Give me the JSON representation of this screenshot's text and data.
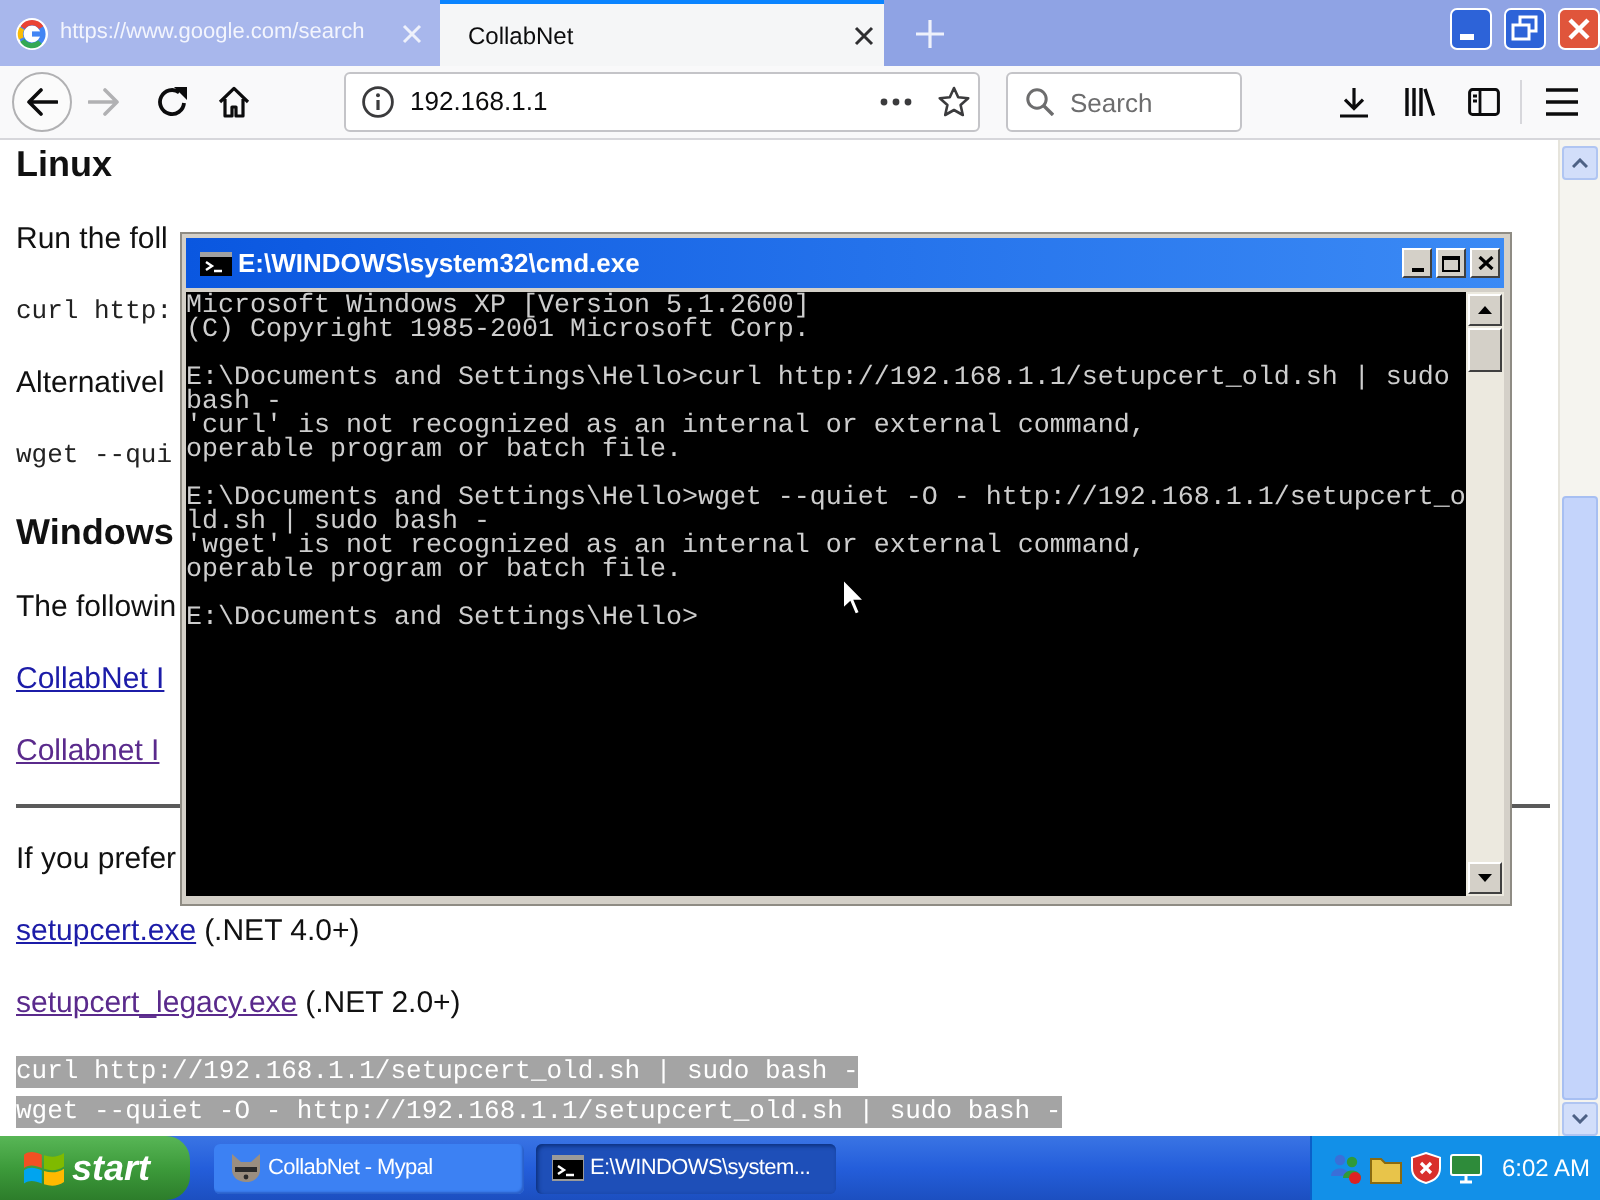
{
  "browser": {
    "tabs": [
      {
        "title": "https://www.google.com/search",
        "favicon": true,
        "selected": false
      },
      {
        "title": "CollabNet",
        "favicon": false,
        "selected": true
      }
    ],
    "nav_buttons": [
      {
        "kind": "back",
        "disabled": false
      },
      {
        "kind": "forward",
        "disabled": true
      },
      {
        "kind": "reload",
        "disabled": false
      },
      {
        "kind": "home",
        "disabled": false
      }
    ],
    "address": "192.168.1.1",
    "search": {
      "placeholder": "Search"
    }
  },
  "page": {
    "blocks": [
      {
        "kind": "heading",
        "text": "Linux"
      },
      {
        "kind": "paragraph",
        "text": "Run the foll"
      },
      {
        "kind": "code",
        "text": "curl http:",
        "selected": false
      },
      {
        "kind": "paragraph",
        "text": "Alternativel"
      },
      {
        "kind": "code",
        "text": "wget --qui",
        "selected": false
      },
      {
        "kind": "heading",
        "text": "Windows"
      },
      {
        "kind": "paragraph",
        "text": "The followin"
      },
      {
        "kind": "link",
        "text": "CollabNet I",
        "visited": false
      },
      {
        "kind": "link",
        "text": "Collabnet I",
        "visited": true
      },
      {
        "kind": "rule"
      },
      {
        "kind": "paragraph",
        "text": "If you prefer"
      },
      {
        "kind": "download",
        "link": "setupcert.exe",
        "visited": false,
        "note": "(.NET 4.0+)"
      },
      {
        "kind": "download",
        "link": "setupcert_legacy.exe",
        "visited": true,
        "note": "(.NET 2.0+)"
      },
      {
        "kind": "code",
        "text": "curl http://192.168.1.1/setupcert_old.sh | sudo bash -",
        "selected": true
      },
      {
        "kind": "code",
        "text": "wget --quiet -O - http://192.168.1.1/setupcert_old.sh | sudo bash -",
        "selected": true
      }
    ]
  },
  "console": {
    "title": "E:\\WINDOWS\\system32\\cmd.exe",
    "blocks": [
      [
        "Microsoft Windows XP [Version 5.1.2600]",
        "(C) Copyright 1985-2001 Microsoft Corp."
      ],
      [
        "E:\\Documents and Settings\\Hello>curl http://192.168.1.1/setupcert_old.sh | sudo",
        "bash -",
        "'curl' is not recognized as an internal or external command,",
        "operable program or batch file."
      ],
      [
        "E:\\Documents and Settings\\Hello>wget --quiet -O - http://192.168.1.1/setupcert_o",
        "ld.sh | sudo bash -",
        "'wget' is not recognized as an internal or external command,",
        "operable program or batch file."
      ],
      [
        "E:\\Documents and Settings\\Hello>"
      ]
    ]
  },
  "taskbar": {
    "start_label": "start",
    "tasks": [
      {
        "kind": "browser",
        "label": "CollabNet - Mypal",
        "selected": false
      },
      {
        "kind": "console",
        "label": "E:\\WINDOWS\\system...",
        "selected": true
      }
    ],
    "clock": "6:02 AM"
  }
}
